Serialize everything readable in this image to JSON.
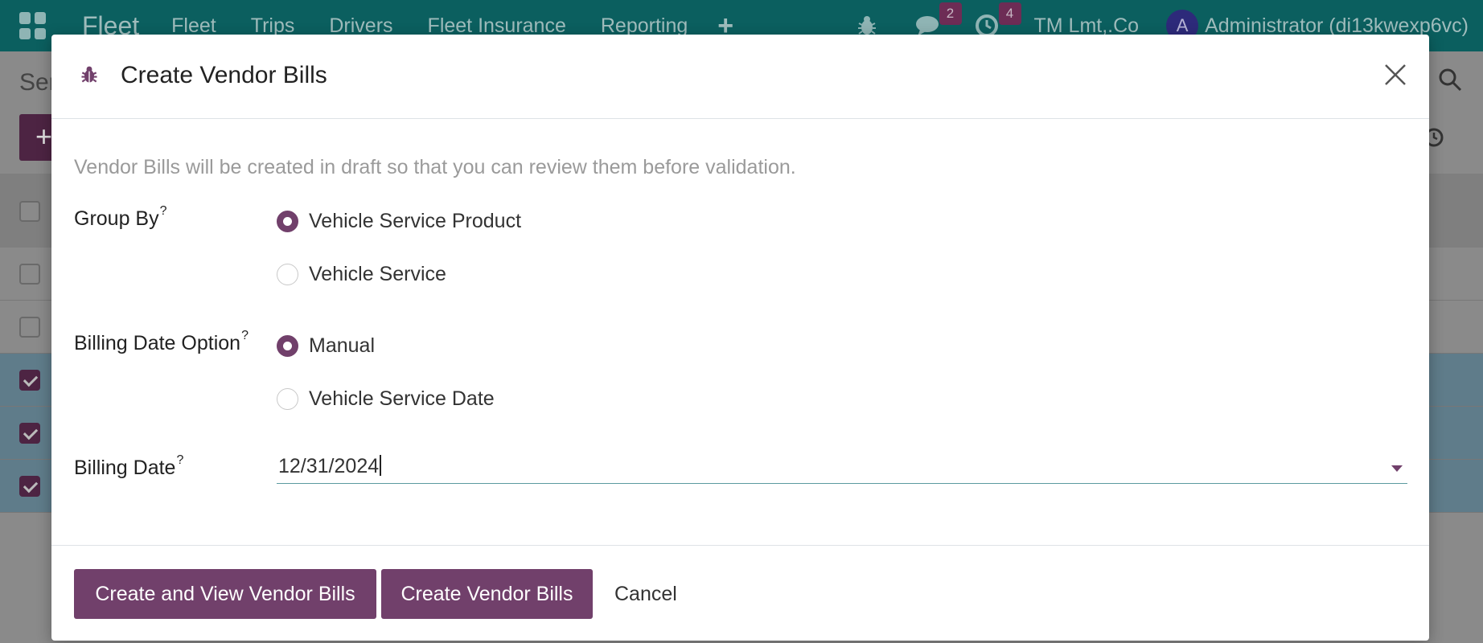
{
  "navbar": {
    "brand": "Fleet",
    "menu": [
      "Fleet",
      "Trips",
      "Drivers",
      "Fleet Insurance",
      "Reporting"
    ],
    "plus": "+",
    "messages_badge": "2",
    "activities_badge": "4",
    "company": "TM Lmt,.Co",
    "avatar_letter": "A",
    "user": "Administrator (di13kwexp6vc)"
  },
  "background": {
    "page_title_partial": "Ser",
    "new_button_symbol": "+"
  },
  "dialog": {
    "title": "Create Vendor Bills",
    "intro": "Vendor Bills will be created in draft so that you can review them before validation.",
    "group_by": {
      "label": "Group By",
      "help": "?",
      "options": [
        {
          "label": "Vehicle Service Product",
          "checked": true
        },
        {
          "label": "Vehicle Service",
          "checked": false
        }
      ]
    },
    "billing_date_option": {
      "label": "Billing Date Option",
      "help": "?",
      "options": [
        {
          "label": "Manual",
          "checked": true
        },
        {
          "label": "Vehicle Service Date",
          "checked": false
        }
      ]
    },
    "billing_date": {
      "label": "Billing Date",
      "help": "?",
      "value": "12/31/2024"
    },
    "buttons": {
      "create_and_view": "Create and View Vendor Bills",
      "create": "Create Vendor Bills",
      "cancel": "Cancel"
    }
  },
  "colors": {
    "primary": "#71406b",
    "navbar": "#0b5f5f",
    "input_border": "#5b9aa0"
  }
}
